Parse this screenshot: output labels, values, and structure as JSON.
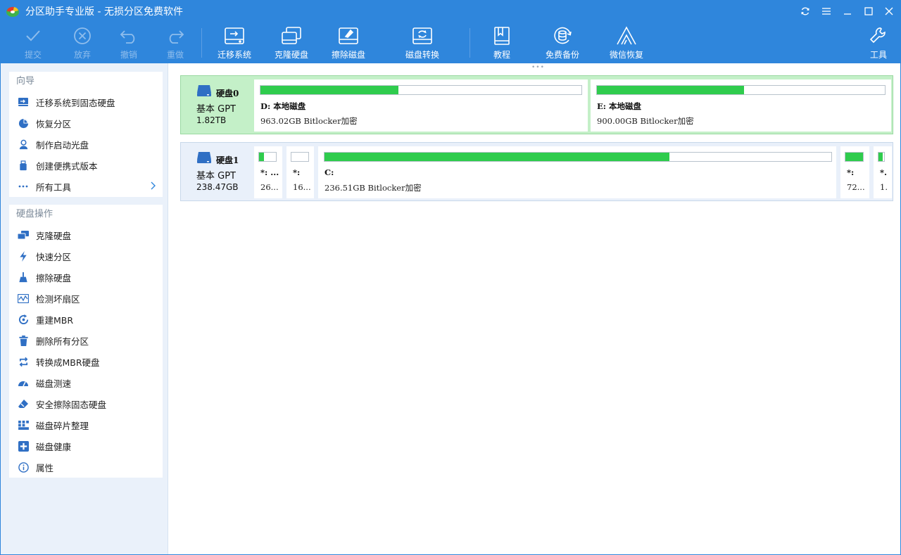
{
  "app": {
    "title": "分区助手专业版 - 无损分区免费软件"
  },
  "window_controls": [
    {
      "name": "refresh-icon"
    },
    {
      "name": "menu-icon"
    },
    {
      "name": "minimize-icon"
    },
    {
      "name": "maximize-icon"
    },
    {
      "name": "close-icon"
    }
  ],
  "toolbar": {
    "submit": "提交",
    "discard": "放弃",
    "undo": "撤销",
    "redo": "重做",
    "migrate": "迁移系统",
    "clone": "克隆硬盘",
    "wipe": "擦除磁盘",
    "convert": "磁盘转换",
    "tutorial": "教程",
    "backup": "免费备份",
    "wechat": "微信恢复",
    "tools": "工具"
  },
  "sidebar": {
    "wizard_title": "向导",
    "wizard_items": [
      {
        "label": "迁移系统到固态硬盘",
        "icon": "migrate-icon"
      },
      {
        "label": "恢复分区",
        "icon": "pie-icon"
      },
      {
        "label": "制作启动光盘",
        "icon": "disc-user-icon"
      },
      {
        "label": "创建便携式版本",
        "icon": "usb-icon"
      },
      {
        "label": "所有工具",
        "icon": "more-icon"
      }
    ],
    "ops_title": "硬盘操作",
    "ops_items": [
      {
        "label": "克隆硬盘",
        "icon": "clone-disk-icon"
      },
      {
        "label": "快速分区",
        "icon": "lightning-icon"
      },
      {
        "label": "擦除硬盘",
        "icon": "broom-icon"
      },
      {
        "label": "检测坏扇区",
        "icon": "scan-icon"
      },
      {
        "label": "重建MBR",
        "icon": "rebuild-icon"
      },
      {
        "label": "删除所有分区",
        "icon": "trash-icon"
      },
      {
        "label": "转换成MBR硬盘",
        "icon": "convert-icon"
      },
      {
        "label": "磁盘测速",
        "icon": "speedometer-icon"
      },
      {
        "label": "安全擦除固态硬盘",
        "icon": "eraser-icon"
      },
      {
        "label": "磁盘碎片整理",
        "icon": "defrag-icon"
      },
      {
        "label": "磁盘健康",
        "icon": "health-icon"
      },
      {
        "label": "属性",
        "icon": "info-icon"
      }
    ]
  },
  "disks": [
    {
      "name": "硬盘0",
      "type": "基本 GPT",
      "size": "1.82TB",
      "selected": true,
      "partitions": [
        {
          "name": "D: 本地磁盘",
          "info": "963.02GB Bitlocker加密",
          "used": 0.43
        },
        {
          "name": "E: 本地磁盘",
          "info": "900.00GB Bitlocker加密",
          "used": 0.51
        }
      ]
    },
    {
      "name": "硬盘1",
      "type": "基本 GPT",
      "size": "238.47GB",
      "selected": false,
      "partitions": [
        {
          "name": "*: ...",
          "info": "26...",
          "used": 0.3
        },
        {
          "name": "*:",
          "info": "16...",
          "used": 0.0
        },
        {
          "name": "C:",
          "info": "236.51GB Bitlocker加密",
          "used": 0.68
        },
        {
          "name": "*:",
          "info": "72...",
          "used": 1.0
        },
        {
          "name": "*.",
          "info": "1.",
          "used": 0.7
        }
      ]
    }
  ],
  "colors": {
    "titlebar": "#2f86dc",
    "usage_fill": "#2fcc4d",
    "selected_row": "#c4f0c8",
    "sidebar_bg": "#eaf1fa"
  }
}
